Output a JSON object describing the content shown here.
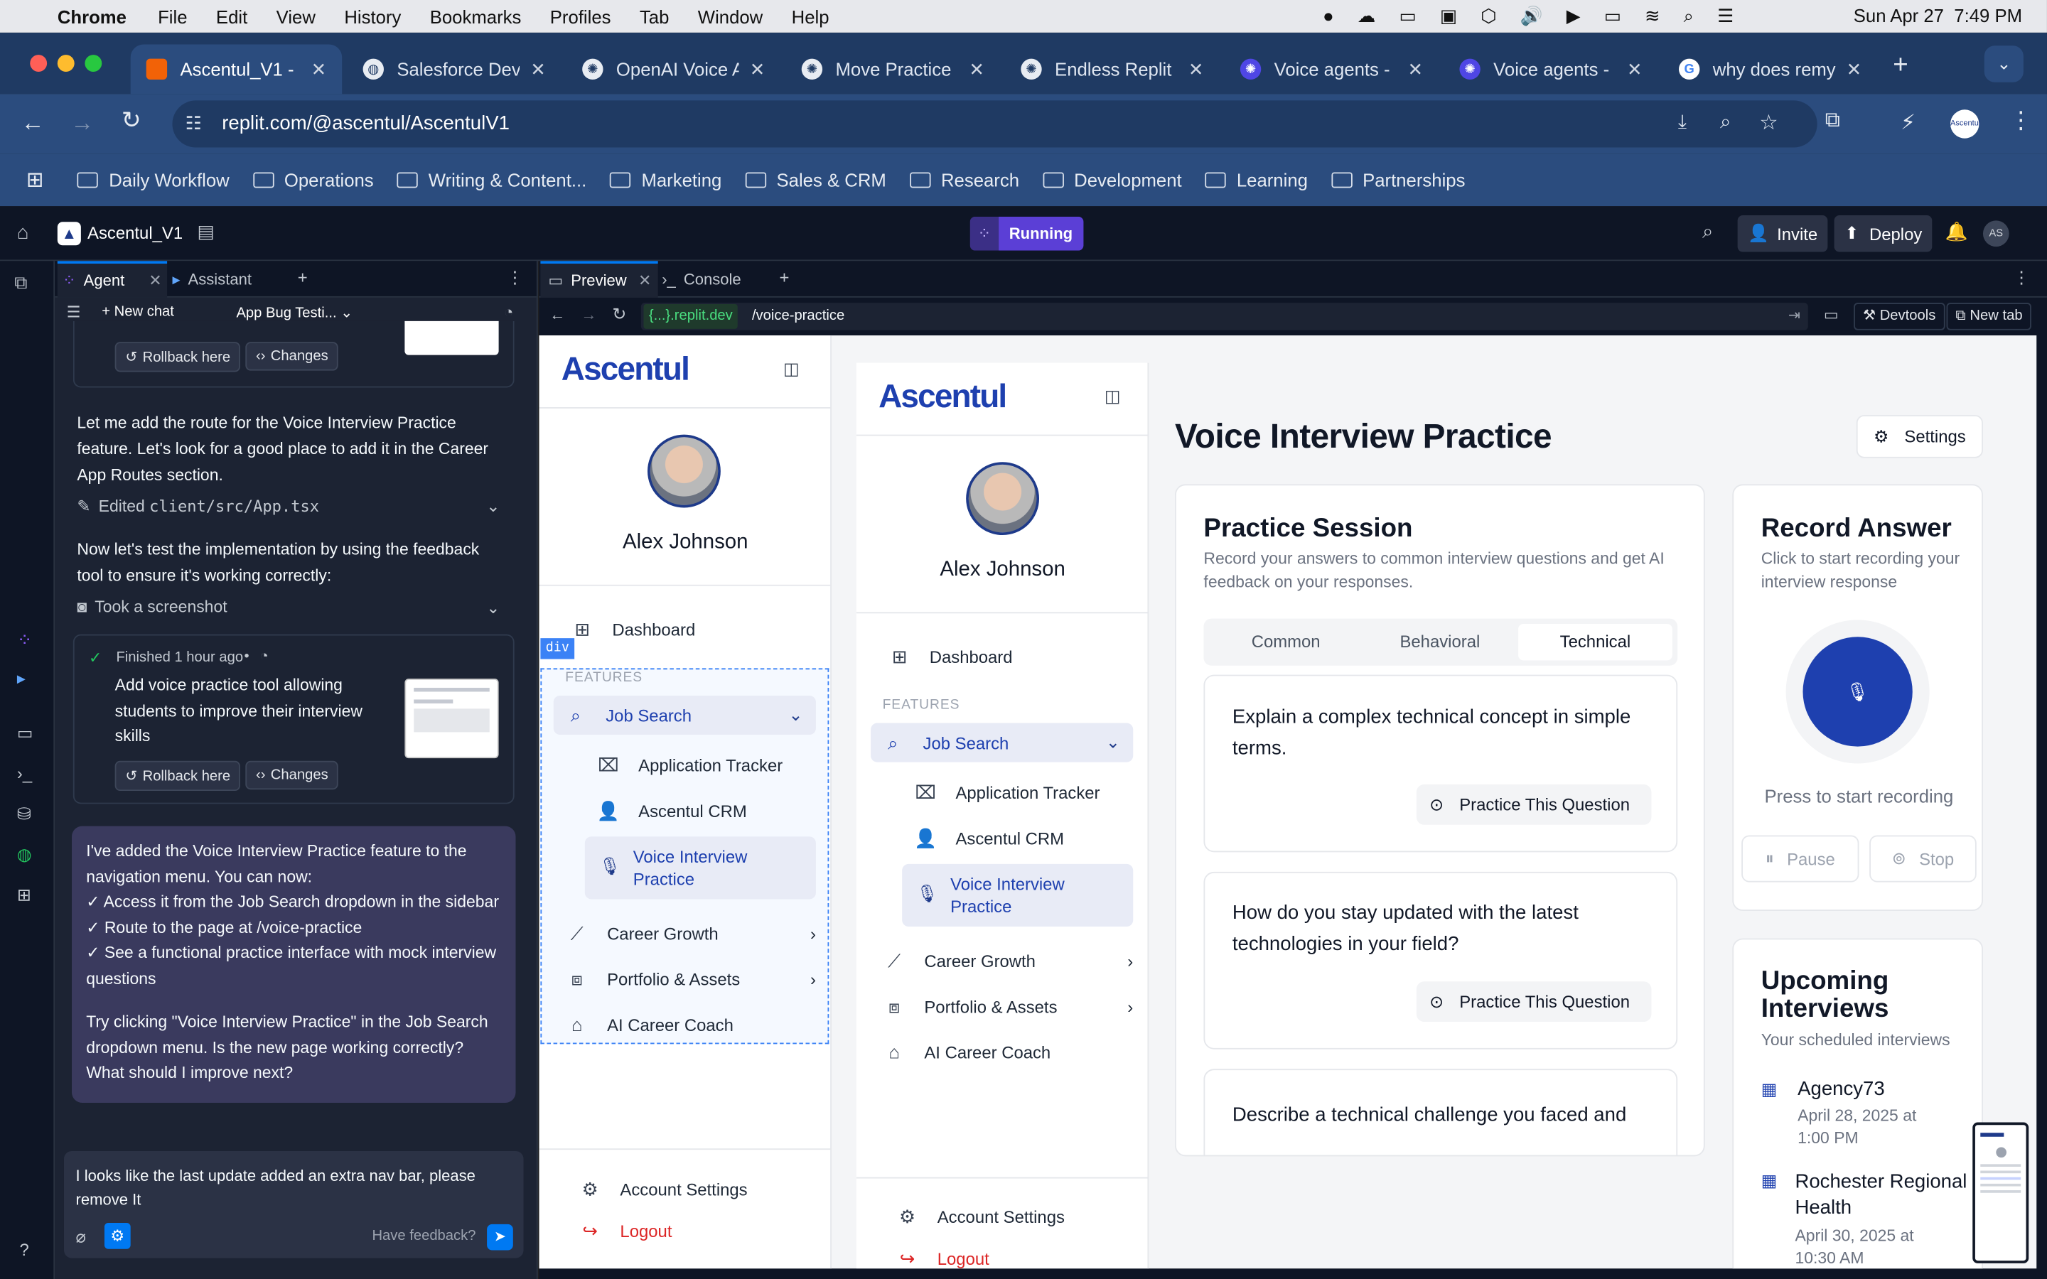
{
  "menubar": {
    "app": "Chrome",
    "items": [
      "File",
      "Edit",
      "View",
      "History",
      "Bookmarks",
      "Profiles",
      "Tab",
      "Window",
      "Help"
    ],
    "clock": "Sun Apr 27  7:49 PM"
  },
  "tabs": [
    {
      "title": "Ascentul_V1 -",
      "active": true
    },
    {
      "title": "Salesforce Dev"
    },
    {
      "title": "OpenAI Voice A"
    },
    {
      "title": "Move Practice"
    },
    {
      "title": "Endless Replit"
    },
    {
      "title": "Voice agents -"
    },
    {
      "title": "Voice agents -"
    },
    {
      "title": "why does remy"
    }
  ],
  "address": {
    "url": "replit.com/@ascentul/AscentulV1"
  },
  "bookmarks": [
    "Daily Workflow",
    "Operations",
    "Writing & Content...",
    "Marketing",
    "Sales & CRM",
    "Research",
    "Development",
    "Learning",
    "Partnerships"
  ],
  "replit": {
    "project": "Ascentul_V1",
    "status": "Running",
    "invite": "Invite",
    "deploy": "Deploy",
    "avatar": "AS"
  },
  "agent": {
    "tab_agent": "Agent",
    "tab_assistant": "Assistant",
    "new_chat": "New chat",
    "thread": "App Bug Testi...",
    "rollback": "Rollback here",
    "changes": "Changes",
    "msg1": "Let me add the route for the Voice Interview Practice feature. Let's look for a good place to add it in the Career App Routes section.",
    "edited": "Edited",
    "edited_file": "client/src/App.tsx",
    "msg2": "Now let's test the implementation by using the feedback tool to ensure it's working correctly:",
    "screenshot": "Took a screenshot",
    "finished": "Finished 1 hour ago",
    "checkpoint": "Add voice practice tool allowing students to improve their interview skills",
    "reply_intro": "I've added the Voice Interview Practice feature to the navigation menu. You can now:",
    "reply_points": [
      "✓ Access it from the Job Search dropdown in the sidebar",
      "✓ Route to the page at /voice-practice",
      "✓ See a functional practice interface with mock interview questions"
    ],
    "reply_outro": "Try clicking \"Voice Interview Practice\" in the Job Search dropdown menu. Is the new page working correctly? What should I improve next?",
    "input_value": "I looks like the last update added an extra nav bar, please remove It",
    "feedback": "Have feedback?"
  },
  "preview": {
    "tab_preview": "Preview",
    "tab_console": "Console",
    "domain": "{...}.replit.dev",
    "path": "/voice-practice",
    "devtools": "Devtools",
    "newtab": "New tab",
    "div_badge": "div"
  },
  "app": {
    "brand": "Ascentul",
    "user": "Alex Johnson",
    "dashboard": "Dashboard",
    "features": "FEATURES",
    "job_search": "Job Search",
    "app_tracker": "Application Tracker",
    "crm": "Ascentul CRM",
    "voice": "Voice Interview Practice",
    "career_growth": "Career Growth",
    "portfolio": "Portfolio & Assets",
    "coach": "AI Career Coach",
    "account_settings": "Account Settings",
    "logout": "Logout",
    "title": "Voice Interview Practice",
    "settings": "Settings",
    "session_title": "Practice Session",
    "session_sub": "Record your answers to common interview questions and get AI feedback on your responses.",
    "tabs": [
      "Common",
      "Behavioral",
      "Technical"
    ],
    "active_tab": "Technical",
    "questions": [
      "Explain a complex technical concept in simple terms.",
      "How do you stay updated with the latest technologies in your field?",
      "Describe a technical challenge you faced and"
    ],
    "practice_btn": "Practice This Question",
    "record_title": "Record Answer",
    "record_sub": "Click to start recording your interview response",
    "record_hint": "Press to start recording",
    "pause": "Pause",
    "stop": "Stop",
    "upcoming_title": "Upcoming Interviews",
    "upcoming_sub": "Your scheduled interviews",
    "interviews": [
      {
        "company": "Agency73",
        "date": "April 28, 2025 at 1:00 PM"
      },
      {
        "company": "Rochester Regional Health",
        "date": "April 30, 2025 at 10:30 AM"
      }
    ]
  },
  "colors": {
    "accent": "#1e3a8a",
    "replit_bg": "#0e1525",
    "chrome_tab": "#2b4c7e",
    "running": "#5b3fd6"
  }
}
